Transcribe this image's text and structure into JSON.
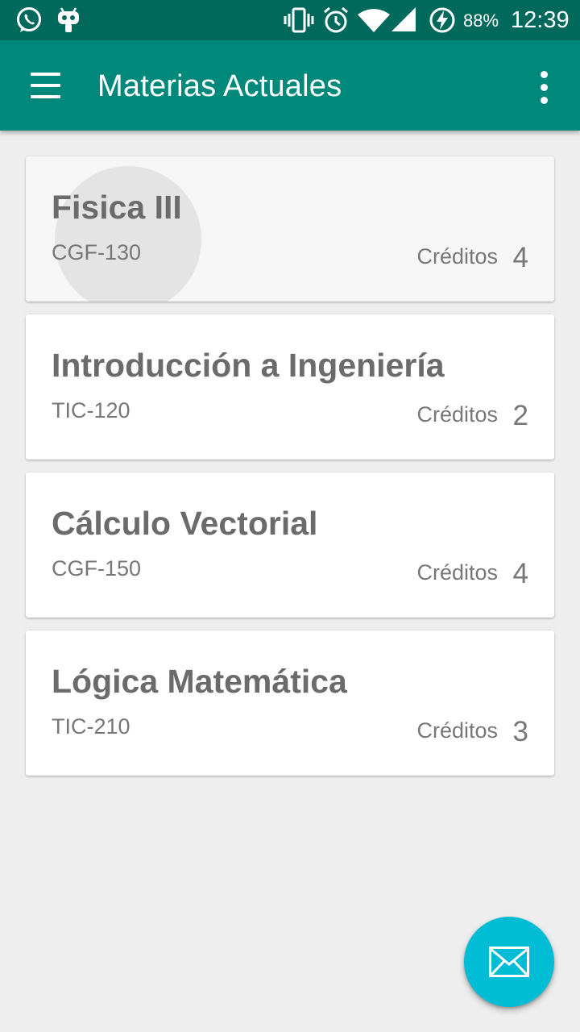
{
  "status_bar": {
    "battery_percent": "88%",
    "time": "12:39",
    "icons": [
      "whatsapp-icon",
      "android-debug-icon",
      "vibrate-icon",
      "alarm-icon",
      "wifi-icon",
      "signal-icon",
      "battery-charging-icon"
    ]
  },
  "app_bar": {
    "title": "Materias Actuales",
    "menu_icon": "hamburger-menu-icon",
    "overflow_icon": "more-vert-icon"
  },
  "courses": [
    {
      "name": "Fisica III",
      "code": "CGF-130",
      "credits_label": "Créditos",
      "credits": "4"
    },
    {
      "name": "Introducción a Ingeniería",
      "code": "TIC-120",
      "credits_label": "Créditos",
      "credits": "2"
    },
    {
      "name": "Cálculo Vectorial",
      "code": "CGF-150",
      "credits_label": "Créditos",
      "credits": "4"
    },
    {
      "name": "Lógica Matemática",
      "code": "TIC-210",
      "credits_label": "Créditos",
      "credits": "3"
    }
  ],
  "fab": {
    "icon": "email-icon"
  },
  "colors": {
    "status_bar": "#00695c",
    "app_bar": "#00897b",
    "fab": "#00bcd4",
    "background": "#eeeeee",
    "card_text": "#6b6b6b"
  }
}
